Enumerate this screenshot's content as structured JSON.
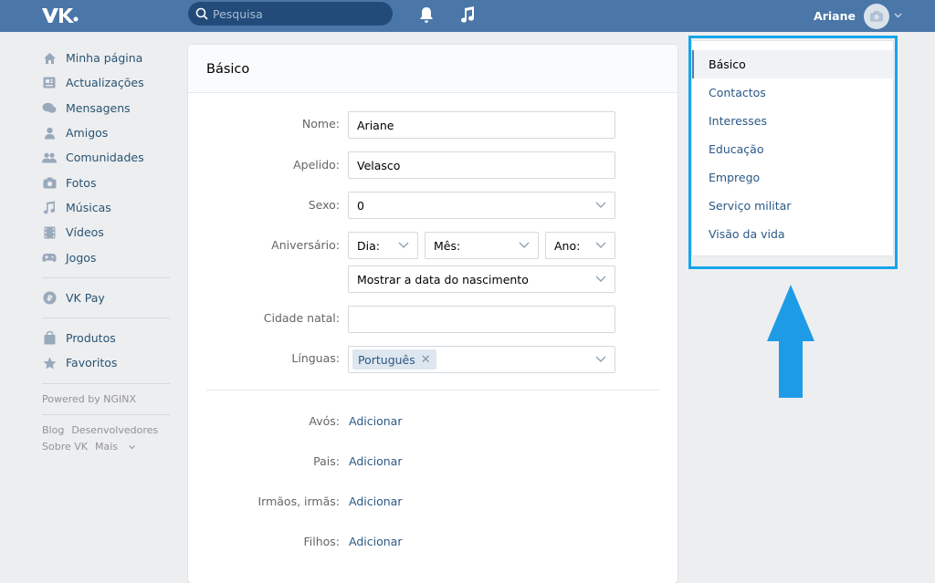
{
  "topbar": {
    "search_placeholder": "Pesquisa",
    "user_name": "Ariane"
  },
  "leftnav": {
    "items": [
      {
        "label": "Minha página",
        "icon": "home-icon"
      },
      {
        "label": "Actualizações",
        "icon": "news-icon"
      },
      {
        "label": "Mensagens",
        "icon": "messages-icon"
      },
      {
        "label": "Amigos",
        "icon": "friends-icon"
      },
      {
        "label": "Comunidades",
        "icon": "communities-icon"
      },
      {
        "label": "Fotos",
        "icon": "camera-icon"
      },
      {
        "label": "Músicas",
        "icon": "music-icon"
      },
      {
        "label": "Vídeos",
        "icon": "video-icon"
      },
      {
        "label": "Jogos",
        "icon": "gamepad-icon"
      }
    ],
    "vkpay": "VK Pay",
    "extra": [
      {
        "label": "Produtos",
        "icon": "bag-icon"
      },
      {
        "label": "Favoritos",
        "icon": "star-icon"
      }
    ],
    "powered": "Powered by NGINX",
    "footer": {
      "blog": "Blog",
      "devs": "Desenvolvedores",
      "about": "Sobre VK",
      "more": "Mais"
    }
  },
  "card": {
    "title": "Básico",
    "fields": {
      "nome_label": "Nome:",
      "nome_value": "Ariane",
      "apelido_label": "Apelido:",
      "apelido_value": "Velasco",
      "sexo_label": "Sexo:",
      "sexo_value": "0",
      "aniv_label": "Aniversário:",
      "dia": "Dia:",
      "mes": "Mês:",
      "ano": "Ano:",
      "show_birth": "Mostrar a data do nascimento",
      "cidade_label": "Cidade natal:",
      "cidade_value": "",
      "linguas_label": "Línguas:",
      "lingua_tag": "Português"
    },
    "relatives": {
      "avos_label": "Avós:",
      "pais_label": "Pais:",
      "irmaos_label": "Irmãos, irmãs:",
      "filhos_label": "Filhos:",
      "add": "Adicionar"
    }
  },
  "rightmenu": {
    "items": [
      "Básico",
      "Contactos",
      "Interesses",
      "Educação",
      "Emprego",
      "Serviço militar",
      "Visão da vida"
    ],
    "active_index": 0
  },
  "colors": {
    "header": "#4a76a8",
    "link": "#2a5885",
    "highlight": "#14a6e8",
    "arrow": "#1e9be6"
  }
}
